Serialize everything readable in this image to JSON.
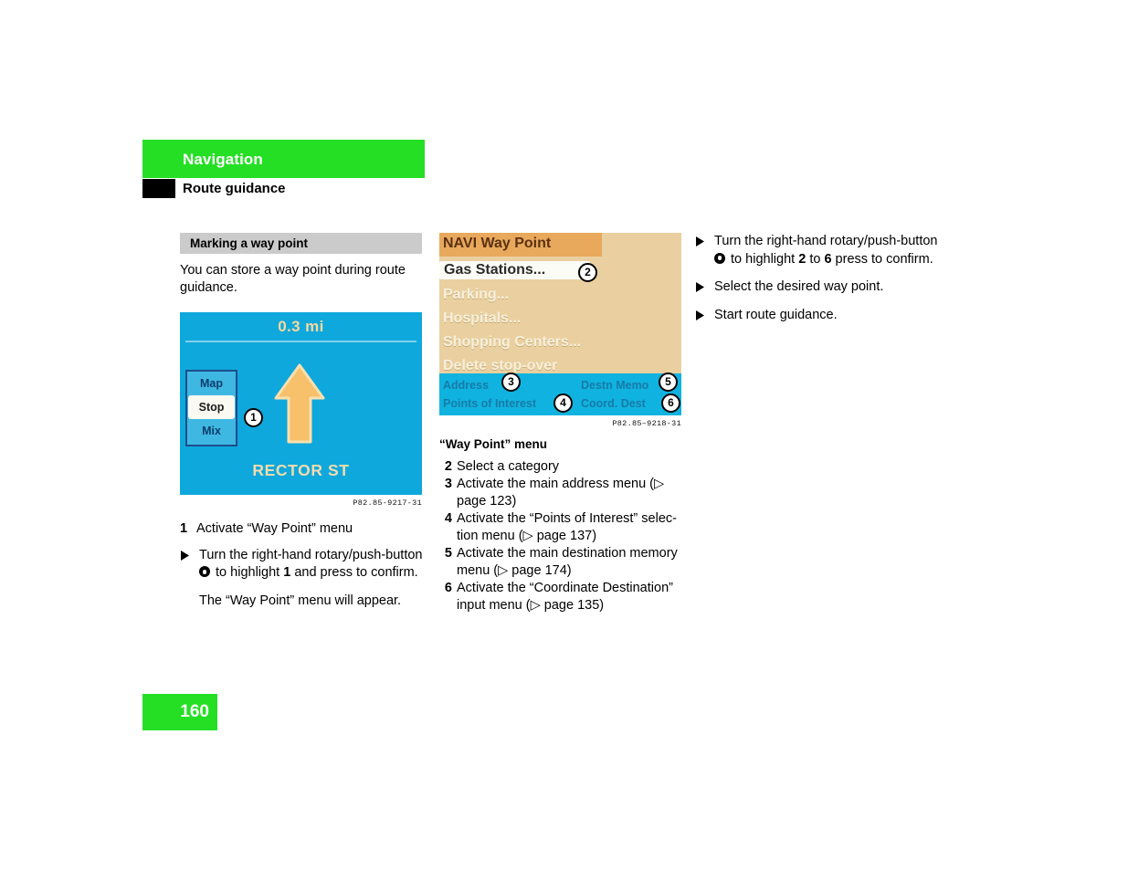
{
  "header": {
    "chapter": "Navigation",
    "section": "Route guidance"
  },
  "page_number": "160",
  "left_column": {
    "subhead": "Marking a way point",
    "intro": "You can store a way point during route guidance.",
    "figure": {
      "part_number": "P82.85-9217-31",
      "distance": "0.3 mi",
      "street": "RECTOR ST",
      "buttons": [
        "Map",
        "Stop",
        "Mix"
      ],
      "selected_button": "Stop",
      "callout": "1",
      "arrow": "straight-ahead-arrow",
      "display_bg": "#0FA8DC",
      "arrow_color": "#F7C06A"
    },
    "step": {
      "num": "1",
      "text": "Activate “Way Point” menu"
    },
    "bullet": {
      "line1": "Turn the right-hand rotary/push-button",
      "line2_pre": "to highlight",
      "line2_bold": "1",
      "line2_post": "and press to confirm."
    },
    "result": "The “Way Point” menu will appear."
  },
  "middle_column": {
    "figure": {
      "part_number": "P82.85–9218-31",
      "title": "NAVI Way Point",
      "items": [
        "Gas Stations...",
        "Parking...",
        "Hospitals...",
        "Shopping Centers...",
        "Delete stop-over"
      ],
      "highlighted_item": "Gas Stations...",
      "footer_items": [
        "Address",
        "Points of Interest",
        "Destn Memo",
        "Coord. Dest"
      ],
      "callouts": [
        "2",
        "3",
        "4",
        "5",
        "6"
      ],
      "header_bg": "#E8A95C",
      "body_bg": "#EAD0A0",
      "footer_bg": "#10B3E0"
    },
    "caption": "“Way Point” menu",
    "legend": [
      {
        "num": "2",
        "text": "Select a category"
      },
      {
        "num": "3",
        "text": "Activate the main address menu (▷ page 123)"
      },
      {
        "num": "4",
        "text": "Activate the “Points of Interest” selec-tion menu (▷ page 137)"
      },
      {
        "num": "5",
        "text": "Activate the main destination memory menu (▷ page 174)"
      },
      {
        "num": "6",
        "text": "Activate the “Coordinate Destination” input menu (▷ page 135)"
      }
    ]
  },
  "right_column": {
    "bullets": [
      {
        "line1": "Turn the right-hand rotary/push-button",
        "line2_pre": "to highlight",
        "line2_b1": "2",
        "line2_mid": "to",
        "line2_b2": "6",
        "line2_post": "press to confirm."
      }
    ],
    "simple_bullets": [
      "Select the desired way point.",
      "Start route guidance."
    ]
  }
}
